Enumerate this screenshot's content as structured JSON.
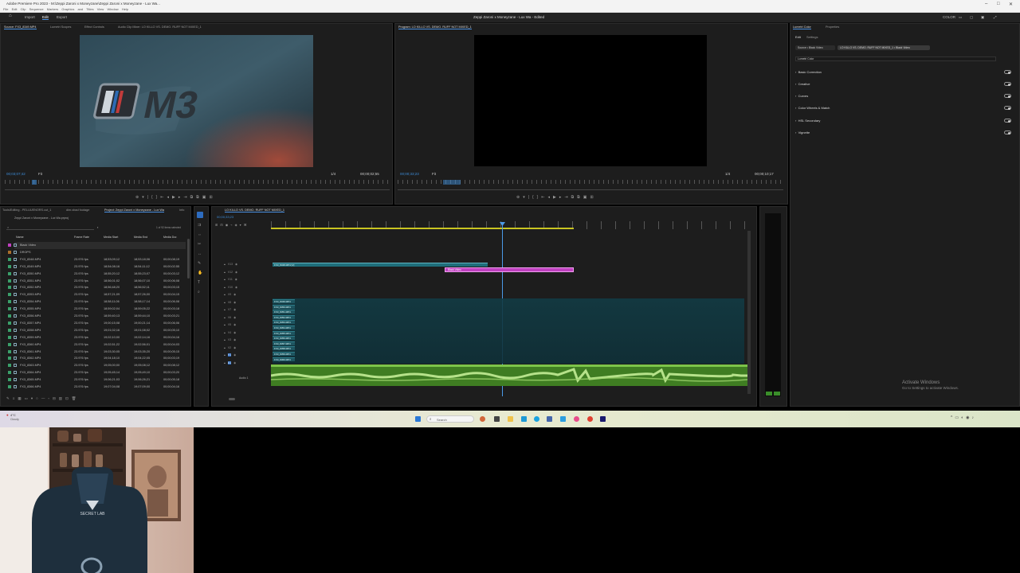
{
  "window": {
    "title": "Adobe Premiere Pro 2023 - M:\\Zeppi Zaroni x Moneyzane\\Zeppi Zaroni x Moneyzane - Lux Wa...",
    "menu": [
      "File",
      "Edit",
      "Clip",
      "Sequence",
      "Markers",
      "Graphics and Titles",
      "View",
      "Window",
      "Help"
    ],
    "center_title": "Zeppi Zaroni x Moneyzane - Lux Wa - Edited"
  },
  "workspace": {
    "tabs": [
      "Import",
      "Edit",
      "Export"
    ],
    "active": "Edit",
    "right_label": "COLOR"
  },
  "source_monitor": {
    "tabs": [
      "Source: FX3_8349.MP4",
      "Lumetri Scopes",
      "Effect Controls",
      "Audio Clip Mixer: LO KILLO VS. DEMO. RUFF NOT MIXED_1"
    ],
    "timecode": "00;03;07;42",
    "fit": "Fit",
    "ratio": "1/4",
    "duration": "00;00;02;55"
  },
  "program_monitor": {
    "tab": "Program: LO KILLO VS. DEMO. RUFF NOT MIXED_1",
    "timecode": "00;00;33;23",
    "fit": "Fit",
    "ratio": "1/4",
    "duration": "00;00;10;17"
  },
  "lumetri": {
    "tabs": [
      "Lumetri Color",
      "Properties"
    ],
    "subtabs": [
      "Edit",
      "Settings"
    ],
    "clip_pills": [
      "Source • Black Video",
      "LO KILLO VS. DEMO. RUFF NOT MIXED_1 • Black Video"
    ],
    "dropdown": "Lumetri Color",
    "sections": [
      "Basic Correction",
      "Creative",
      "Curves",
      "Color Wheels & Match",
      "HSL Secondary",
      "Vignette"
    ]
  },
  "project": {
    "tabs": [
      "Tools/Editing - PELUUENORS.cut_1",
      "dim-vbad footage",
      "Project: Zeppi Zaroni x Moneyzane - Lux Wa",
      "Info"
    ],
    "name": "Zeppi Zaroni x Moneyzane - Lux Wa.prproj",
    "count": "1 of 92 items selected",
    "columns": [
      "Name",
      "Frame Rate",
      "Media Start",
      "Media End",
      "Media Dur."
    ],
    "rows": [
      {
        "name": "Black Video",
        "fps": "",
        "start": "",
        "end": "",
        "dur": ""
      },
      {
        "name": "DROPS",
        "fps": "",
        "start": "",
        "end": "",
        "dur": ""
      },
      {
        "name": "FX3_8348.MP4",
        "fps": "23.976 fps",
        "start": "18;53;09;12",
        "end": "18;53;18;06",
        "dur": "00;00;08;19"
      },
      {
        "name": "FX3_8349.MP4",
        "fps": "23.976 fps",
        "start": "18;54;08;16",
        "end": "18;54;11;12",
        "dur": "00;00;02;55"
      },
      {
        "name": "FX3_8350.MP4",
        "fps": "23.976 fps",
        "start": "18;55;20;12",
        "end": "18;55;23;07",
        "dur": "00;00;03;12"
      },
      {
        "name": "FX3_8351.MP4",
        "fps": "23.976 fps",
        "start": "18;56;01;02",
        "end": "18;56;07;10",
        "dur": "00;00;06;08"
      },
      {
        "name": "FX3_8352.MP4",
        "fps": "23.976 fps",
        "start": "18;56;48;20",
        "end": "18;56;52;11",
        "dur": "00;00;03;15"
      },
      {
        "name": "FX3_8353.MP4",
        "fps": "23.976 fps",
        "start": "18;57;21;09",
        "end": "18;57;26;00",
        "dur": "00;00;04;15"
      },
      {
        "name": "FX3_8354.MP4",
        "fps": "23.976 fps",
        "start": "18;58;11;06",
        "end": "18;58;17;14",
        "dur": "00;00;06;08"
      },
      {
        "name": "FX3_8355.MP4",
        "fps": "23.976 fps",
        "start": "18;59;02;04",
        "end": "18;59;05;22",
        "dur": "00;00;03;18"
      },
      {
        "name": "FX3_8356.MP4",
        "fps": "23.976 fps",
        "start": "18;59;40;13",
        "end": "18;59;44;10",
        "dur": "00;00;03;21"
      },
      {
        "name": "FX3_8357.MP4",
        "fps": "23.976 fps",
        "start": "19;00;15;08",
        "end": "19;00;21;14",
        "dur": "00;00;06;06"
      },
      {
        "name": "FX3_8358.MP4",
        "fps": "23.976 fps",
        "start": "19;01;02;16",
        "end": "19;01;08;02",
        "dur": "00;00;05;10"
      },
      {
        "name": "FX3_8359.MP4",
        "fps": "23.976 fps",
        "start": "19;02;10;00",
        "end": "19;02;14;16",
        "dur": "00;00;04;16"
      },
      {
        "name": "FX3_8360.MP4",
        "fps": "23.976 fps",
        "start": "19;02;51;22",
        "end": "19;02;56;01",
        "dur": "00;00;04;03"
      },
      {
        "name": "FX3_8361.MP4",
        "fps": "23.976 fps",
        "start": "19;03;30;05",
        "end": "19;03;35;20",
        "dur": "00;00;05;15"
      },
      {
        "name": "FX3_8362.MP4",
        "fps": "23.976 fps",
        "start": "19;04;18;10",
        "end": "19;04;22;05",
        "dur": "00;00;03;19"
      },
      {
        "name": "FX3_8363.MP4",
        "fps": "23.976 fps",
        "start": "19;05;00;00",
        "end": "19;05;08;12",
        "dur": "00;00;08;12"
      },
      {
        "name": "FX3_8364.MP4",
        "fps": "23.976 fps",
        "start": "19;05;45;14",
        "end": "19;05;49;10",
        "dur": "00;00;03;20"
      },
      {
        "name": "FX3_8365.MP4",
        "fps": "23.976 fps",
        "start": "19;06;21;03",
        "end": "19;06;26;21",
        "dur": "00;00;05;18"
      },
      {
        "name": "FX3_8366.MP4",
        "fps": "23.976 fps",
        "start": "19;07;04;08",
        "end": "19;07;09;00",
        "dur": "00;00;04;16"
      }
    ]
  },
  "timeline": {
    "tab": "LO KILLO VS. DEMO. RUFF NOT MIXED_1",
    "timecode": "00;00;33;23",
    "clip_label_top": "FX3_8348.MP4 [V]",
    "black_video_label": "Black Video",
    "stack_labels": [
      "FX3_8349.MP4",
      "FX3_8350.MP4",
      "FX3_8351.MP4",
      "FX3_8352.MP4",
      "FX3_8353.MP4",
      "FX3_8354.MP4",
      "FX3_8355.MP4",
      "FX3_8356.MP4",
      "FX3_8357.MP4",
      "FX3_8358.MP4",
      "FX3_8359.MP4",
      "FX3_8360.MP4"
    ],
    "tracks": [
      "V13",
      "V12",
      "V11",
      "V10",
      "V9",
      "V8",
      "V7",
      "V6",
      "V5",
      "V4",
      "V3",
      "V2",
      "V1",
      "A1"
    ],
    "audio_label": "Audio 1"
  },
  "watermark": {
    "title": "Activate Windows",
    "subtitle": "Go to Settings to activate Windows."
  },
  "taskbar": {
    "search": "Search",
    "weather": "4°C",
    "weather_sub": "Cloudy"
  },
  "webcam": {
    "chair_brand": "SECRET LAB"
  },
  "colors": {
    "accent": "#3d8bd6",
    "black_video_clip": "#c040c0",
    "audio_clip": "#5aa832",
    "video_clip": "#1e5560"
  }
}
